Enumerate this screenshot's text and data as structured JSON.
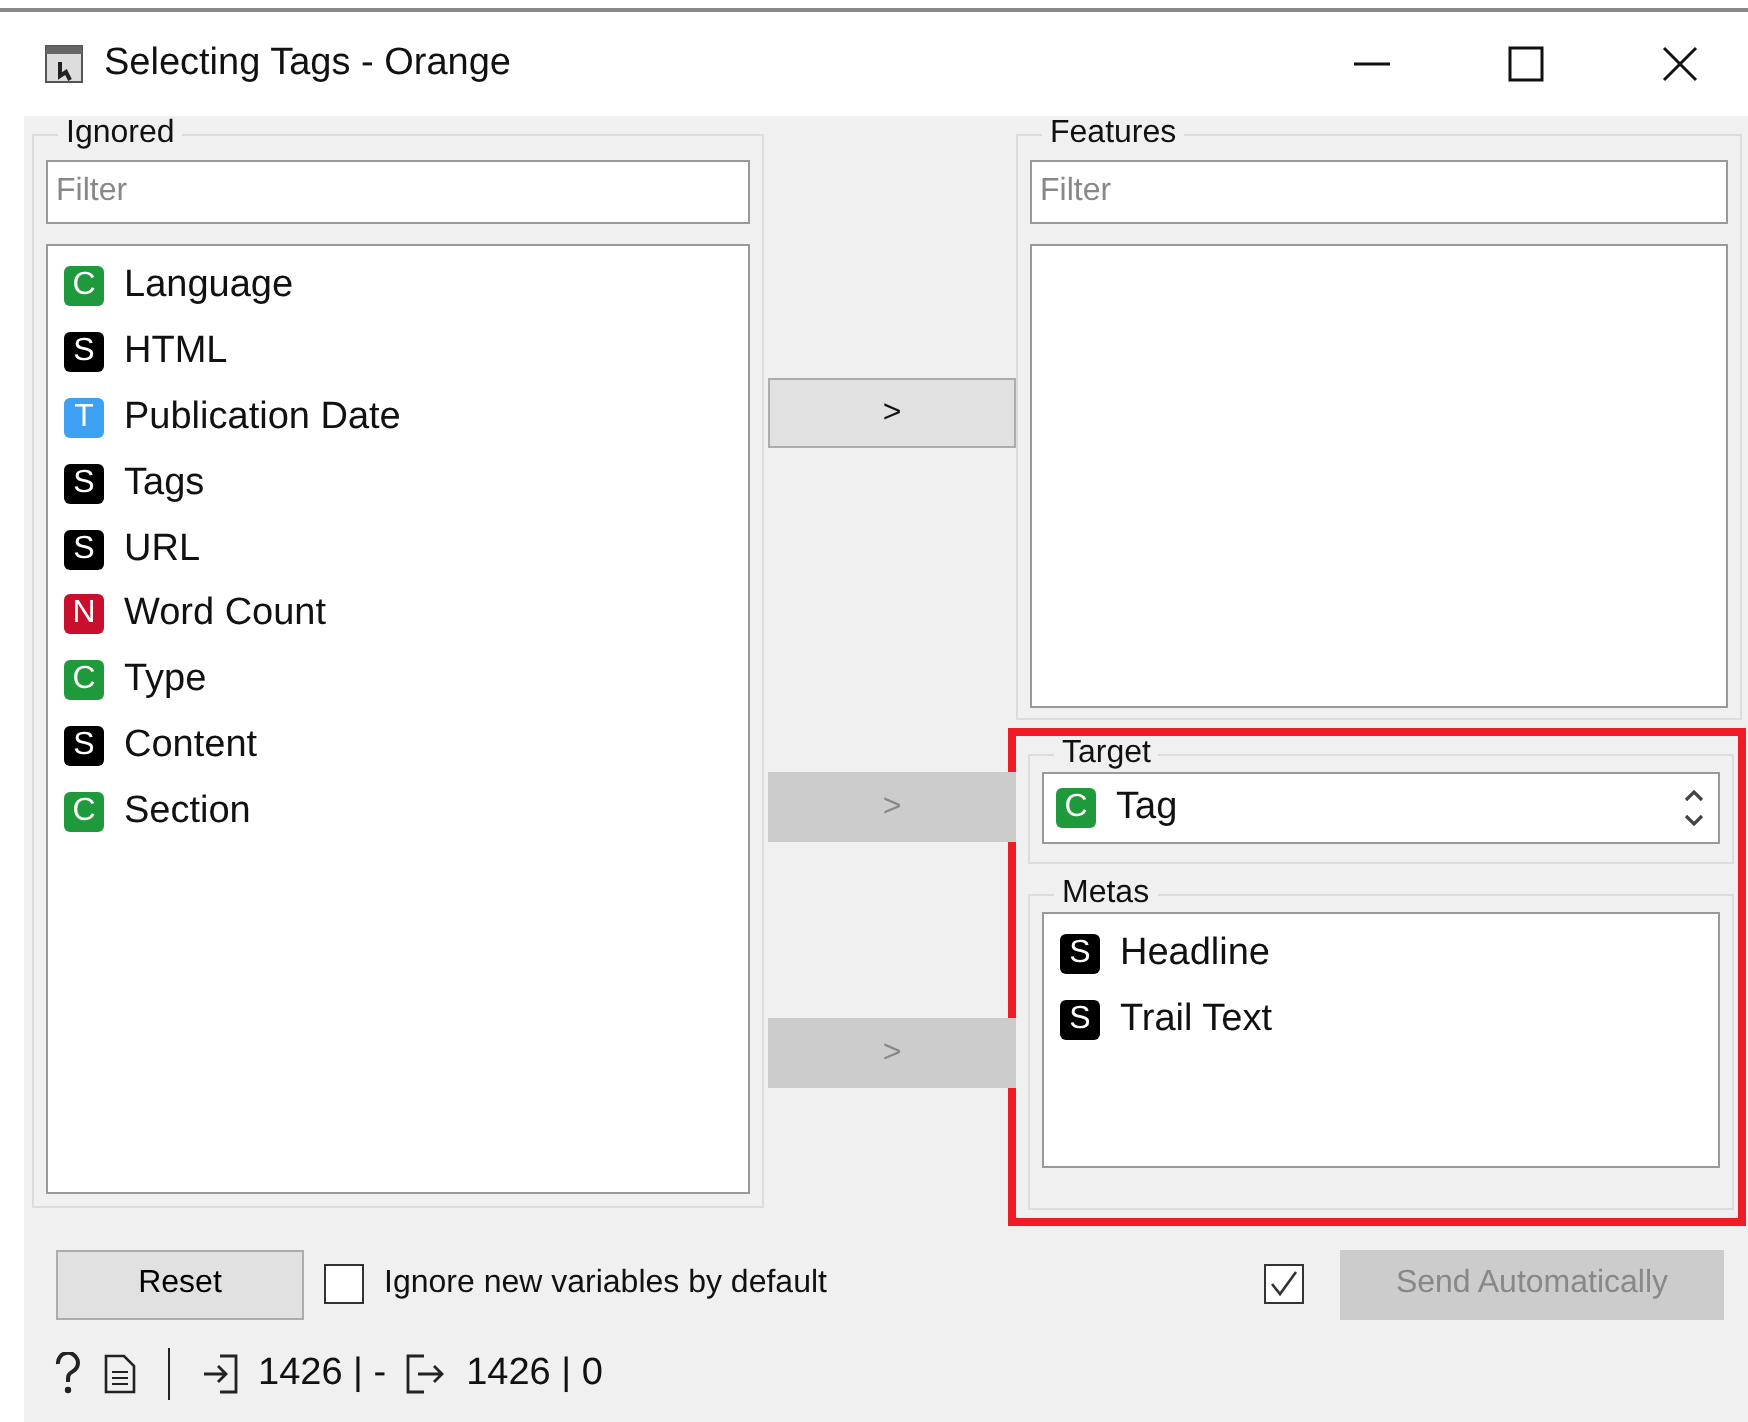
{
  "window": {
    "title": "Selecting Tags - Orange"
  },
  "ignored": {
    "label": "Ignored",
    "filter": {
      "placeholder": "Filter"
    },
    "items": [
      {
        "badge": "C",
        "color": "#1e9a3c",
        "name": "Language"
      },
      {
        "badge": "S",
        "color": "#000000",
        "name": "HTML"
      },
      {
        "badge": "T",
        "color": "#3ea0f2",
        "name": "Publication Date"
      },
      {
        "badge": "S",
        "color": "#000000",
        "name": "Tags"
      },
      {
        "badge": "S",
        "color": "#000000",
        "name": "URL"
      },
      {
        "badge": "N",
        "color": "#c8102e",
        "name": "Word Count"
      },
      {
        "badge": "C",
        "color": "#1e9a3c",
        "name": "Type"
      },
      {
        "badge": "S",
        "color": "#000000",
        "name": "Content"
      },
      {
        "badge": "C",
        "color": "#1e9a3c",
        "name": "Section"
      }
    ]
  },
  "move_buttons": [
    {
      "label": ">",
      "disabled": false
    },
    {
      "label": ">",
      "disabled": true
    },
    {
      "label": ">",
      "disabled": true
    }
  ],
  "features": {
    "label": "Features",
    "filter": {
      "placeholder": "Filter"
    }
  },
  "highlighted": true,
  "target": {
    "label": "Target",
    "value": {
      "badge": "C",
      "color": "#1e9a3c",
      "name": "Tag"
    }
  },
  "metas": {
    "label": "Metas",
    "items": [
      {
        "badge": "S",
        "color": "#000000",
        "name": "Headline"
      },
      {
        "badge": "S",
        "color": "#000000",
        "name": "Trail Text"
      }
    ]
  },
  "reset_button": "Reset",
  "ignore_new": {
    "label": "Ignore new variables by default",
    "checked": false
  },
  "auto_send": {
    "checked": true,
    "label": "Send Automatically",
    "disabled": true
  },
  "status": {
    "input": "1426 | -",
    "output": "1426 | 0"
  }
}
